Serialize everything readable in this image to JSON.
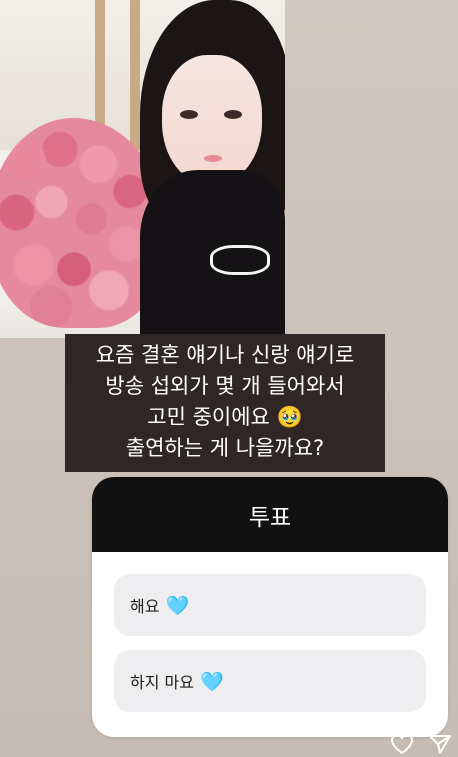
{
  "caption": {
    "lines": [
      "요즘 결혼 얘기나 신랑 얘기로",
      "방송 섭외가 몇 개 들어와서",
      "고민 중이에요 🥹",
      "출연하는 게 나을까요?"
    ]
  },
  "poll": {
    "title": "투표",
    "options": [
      {
        "label": "해요",
        "emoji": "🩵"
      },
      {
        "label": "하지 마요",
        "emoji": "🩵"
      }
    ]
  },
  "icons": {
    "like": "heart-outline-icon",
    "share": "paper-plane-icon"
  },
  "colors": {
    "poll_header": "#111111",
    "option_bg": "#eeeef0",
    "caption_bg": "#2f2725",
    "heart": "#5ec6e6"
  }
}
